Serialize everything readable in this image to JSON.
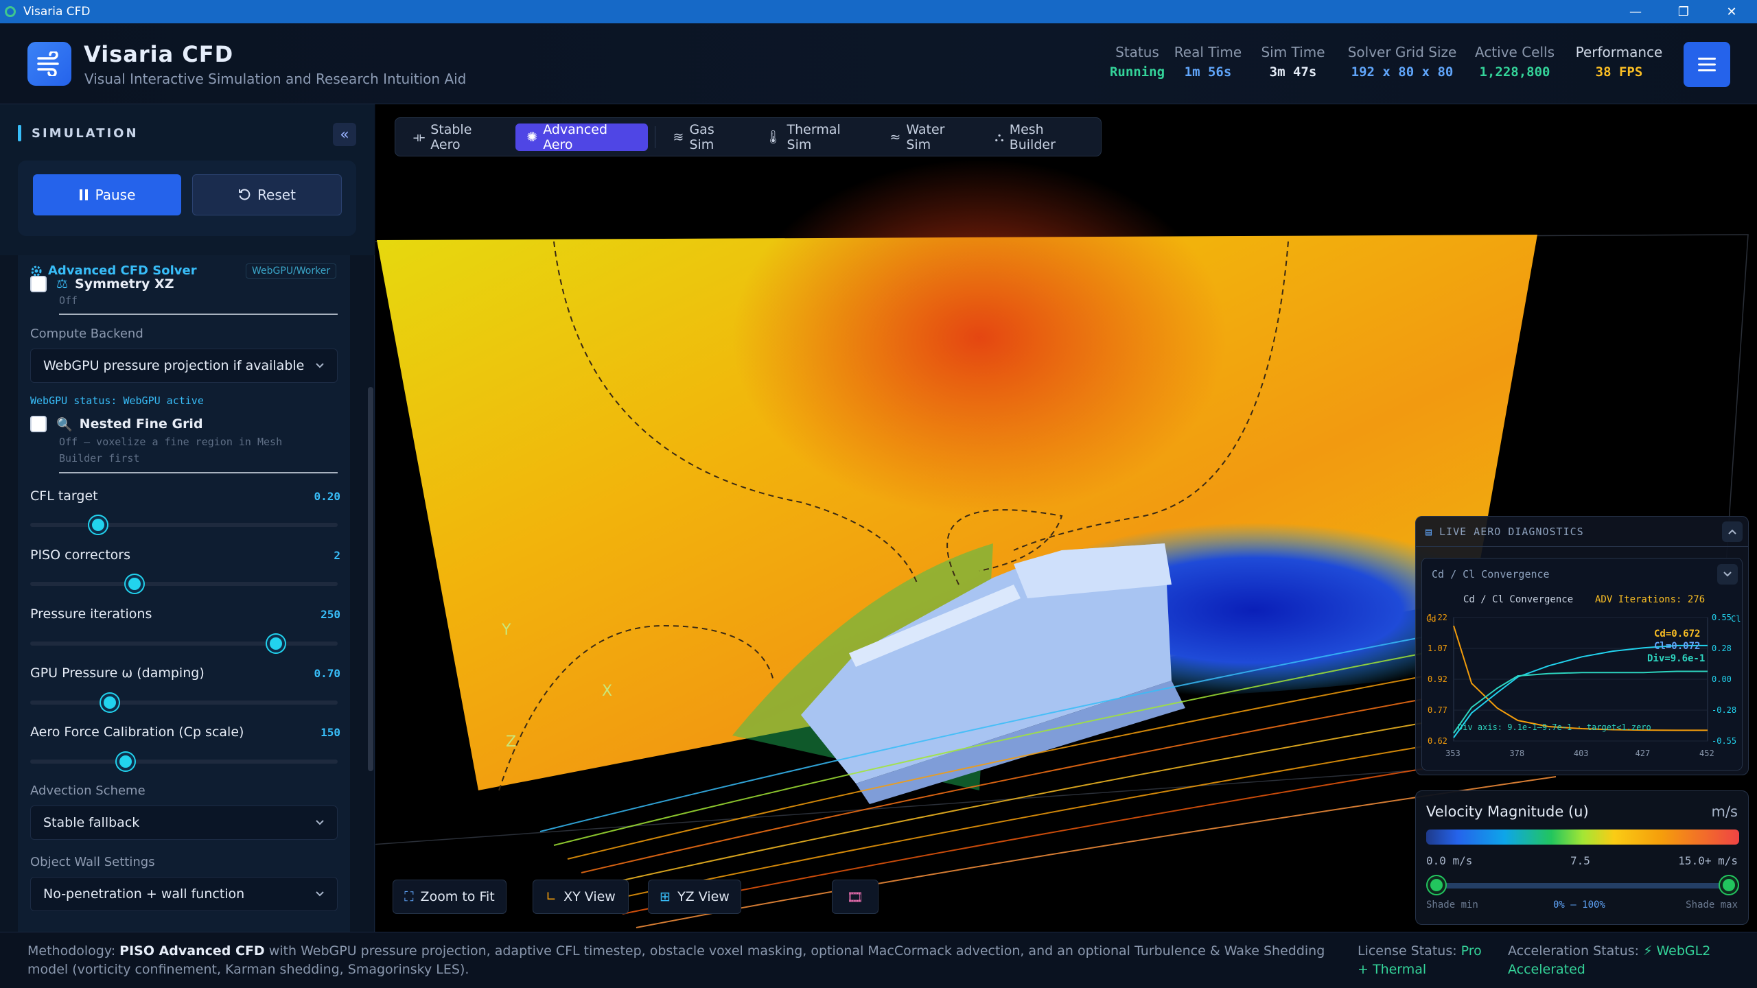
{
  "window": {
    "title": "Visaria CFD",
    "controls": [
      "—",
      "❐",
      "✕"
    ]
  },
  "header": {
    "title": "Visaria CFD",
    "subtitle": "Visual Interactive Simulation and Research Intuition Aid",
    "stats": [
      {
        "label": "Status",
        "value": "Running",
        "color": "#34d399"
      },
      {
        "label": "Real Time",
        "value": "1m 56s",
        "color": "#60a5fa"
      },
      {
        "label": "Sim Time",
        "value": "3m 47s",
        "color": "#e5ecf7"
      },
      {
        "label": "Solver Grid Size",
        "value": "192 x 80 x 80",
        "color": "#60a5fa"
      },
      {
        "label": "Active Cells",
        "value": "1,228,800",
        "color": "#34d399"
      },
      {
        "label": "Performance",
        "value": "38 FPS",
        "color": "#fbbf24"
      }
    ]
  },
  "sidebar": {
    "section_label": "SIMULATION",
    "pause_label": "Pause",
    "reset_label": "Reset",
    "solver_title": "Advanced CFD Solver",
    "solver_tag": "WebGPU/Worker",
    "symmetry": {
      "label": "Symmetry XZ",
      "sub": "Off",
      "checked": false
    },
    "compute_backend_label": "Compute Backend",
    "compute_backend_value": "WebGPU pressure projection if available",
    "gpu_status": "WebGPU status: WebGPU active",
    "nested": {
      "label": "Nested Fine Grid",
      "sub1": "Off — voxelize a fine region in Mesh",
      "sub2": "Builder first",
      "checked": false
    },
    "sliders": [
      {
        "label": "CFL target",
        "value": "0.20",
        "fraction": 0.22
      },
      {
        "label": "PISO correctors",
        "value": "2",
        "fraction": 0.34
      },
      {
        "label": "Pressure iterations",
        "value": "250",
        "fraction": 0.8
      },
      {
        "label": "GPU Pressure ω (damping)",
        "value": "0.70",
        "fraction": 0.26
      },
      {
        "label": "Aero Force Calibration (Cp scale)",
        "value": "150",
        "fraction": 0.31
      }
    ],
    "advection_label": "Advection Scheme",
    "advection_value": "Stable fallback",
    "wall_label": "Object Wall Settings",
    "wall_value": "No-penetration + wall function"
  },
  "tabs": [
    {
      "label": "Stable Aero",
      "icon": "stable-aero-icon",
      "active": false
    },
    {
      "label": "Advanced Aero",
      "icon": "advanced-aero-icon",
      "active": true
    },
    {
      "label": "Gas Sim",
      "icon": "wind-icon",
      "active": false
    },
    {
      "label": "Thermal Sim",
      "icon": "thermometer-icon",
      "active": false
    },
    {
      "label": "Water Sim",
      "icon": "waves-icon",
      "active": false
    },
    {
      "label": "Mesh Builder",
      "icon": "mesh-icon",
      "active": false
    }
  ],
  "viewport": {
    "zoom_fit_label": "Zoom to Fit",
    "xy_view_label": "XY View",
    "yz_view_label": "YZ View",
    "axis_labels": [
      "Y",
      "X",
      "Z"
    ]
  },
  "diagnostics": {
    "header": "LIVE AERO DIAGNOSTICS",
    "card_title": "Cd / Cl Convergence",
    "chart_title": "Cd / Cl Convergence",
    "iterations": "ADV Iterations: 276",
    "cd_label": "Cd=0.672",
    "cl_label": "Cl=0.072",
    "div_label": "Div=9.6e-1",
    "div_axis_note": "Div axis: 9.1e-1–9.7e-1 · target<1.zero",
    "left_axis_name": "Cd",
    "right_axis_name": "Cl"
  },
  "chart_data": {
    "type": "line",
    "title": "Cd / Cl Convergence",
    "x": [
      353,
      360,
      370,
      378,
      390,
      403,
      415,
      427,
      440,
      452
    ],
    "xticks": [
      "353",
      "378",
      "403",
      "427",
      "452"
    ],
    "yticks_left": [
      "1.22",
      "1.07",
      "0.92",
      "0.77",
      "0.62"
    ],
    "yticks_right": [
      "0.55",
      "0.28",
      "0.00",
      "-0.28",
      "-0.55"
    ],
    "ylim_left": [
      0.62,
      1.22
    ],
    "ylim_right": [
      -0.55,
      0.55
    ],
    "series": [
      {
        "name": "Cd",
        "axis": "left",
        "color": "#f59e0b",
        "values": [
          1.18,
          0.9,
          0.78,
          0.72,
          0.69,
          0.68,
          0.675,
          0.673,
          0.672,
          0.672
        ]
      },
      {
        "name": "Cl",
        "axis": "right",
        "color": "#22d3ee",
        "values": [
          -0.52,
          -0.3,
          -0.12,
          0.02,
          0.12,
          0.2,
          0.25,
          0.28,
          0.3,
          0.3
        ]
      },
      {
        "name": "Div",
        "axis": "right",
        "color": "#2dd4bf",
        "values": [
          -0.48,
          -0.25,
          -0.08,
          0.03,
          0.05,
          0.06,
          0.06,
          0.06,
          0.07,
          0.07
        ]
      }
    ]
  },
  "legend": {
    "title": "Velocity Magnitude (u)",
    "unit": "m/s",
    "min": "0.0 m/s",
    "mid": "7.5",
    "max": "15.0+ m/s",
    "shade_min": "Shade min",
    "shade_range": "0% – 100%",
    "shade_max": "Shade max",
    "shade_min_fraction": 0.0,
    "shade_max_fraction": 1.0
  },
  "footer": {
    "method_prefix": "Methodology: ",
    "method_bold": "PISO Advanced CFD",
    "method_rest": " with WebGPU pressure projection, adaptive CFL timestep, obstacle voxel masking, optional MacCormack advection, and an optional Turbulence & Wake Shedding model (vorticity confinement, Karman shedding, Smagorinsky LES).",
    "license_label": "License Status: ",
    "license_value": "Pro + Thermal",
    "accel_label": "Acceleration Status: ",
    "accel_value": "⚡ WebGL2 Accelerated"
  }
}
